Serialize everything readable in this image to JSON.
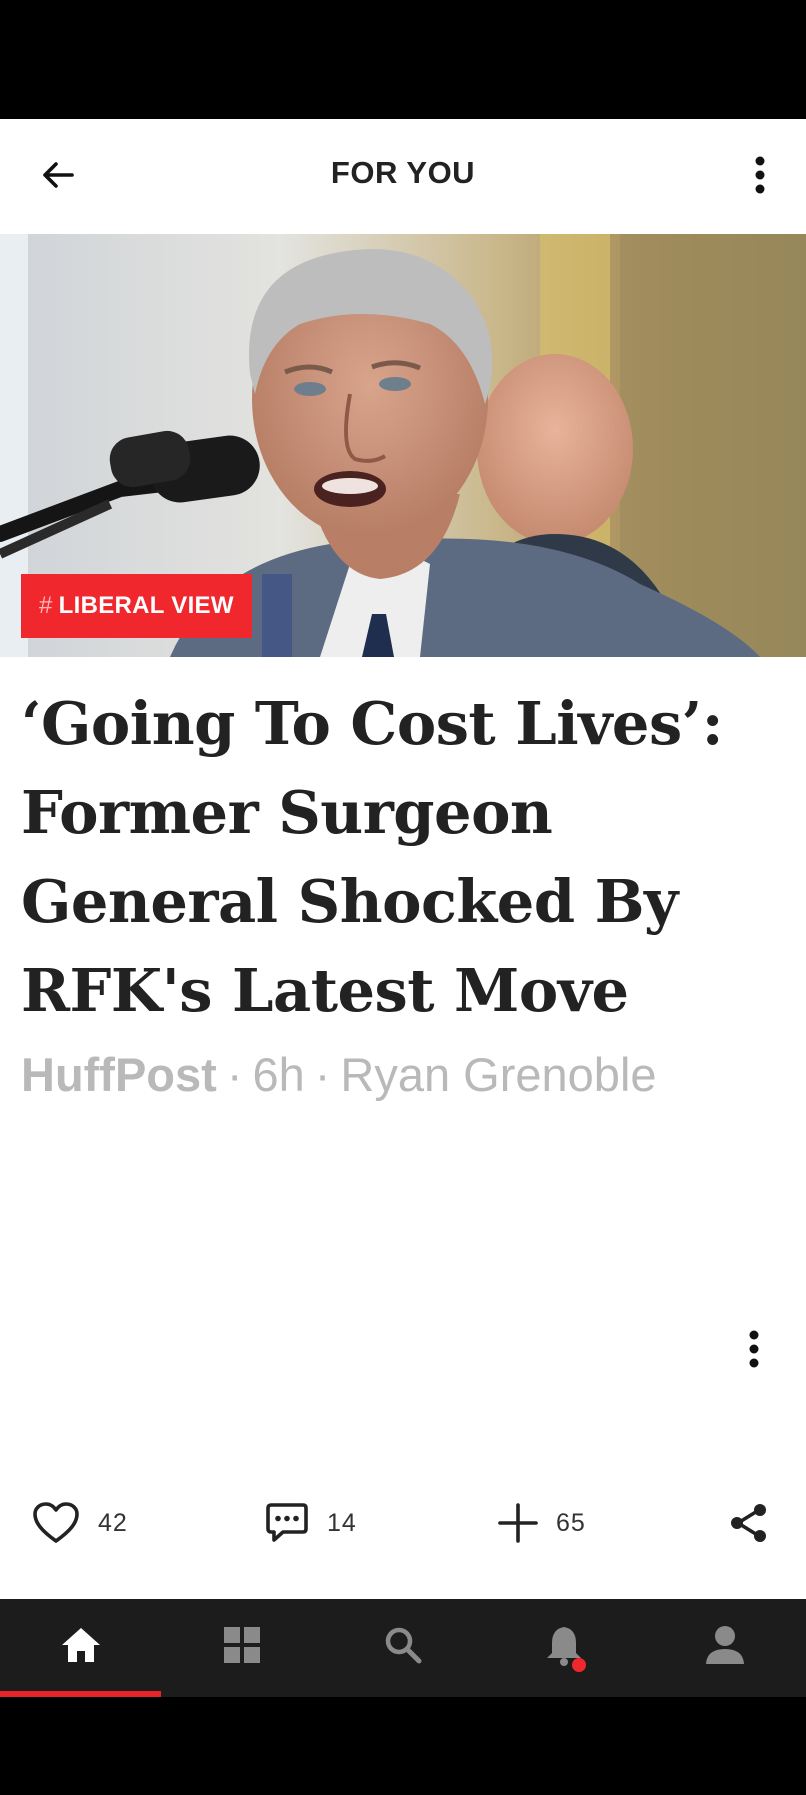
{
  "header": {
    "title": "FOR YOU",
    "back_icon": "arrow-left-icon",
    "more_icon": "more-vertical-icon"
  },
  "article": {
    "tag_hash": "#",
    "tag_label": "LIBERAL VIEW",
    "headline_lines": [
      "‘Going To Cost Lives’:",
      "Former Surgeon",
      "General Shocked By",
      "RFK's Latest Move"
    ],
    "source": "HuffPost",
    "separator": "·",
    "age": "6h",
    "author": "Ryan Grenoble",
    "image_alt": "Man speaking at microphone"
  },
  "actions": {
    "likes": "42",
    "comments": "14",
    "adds": "65"
  },
  "nav": {
    "items": [
      "home",
      "sections",
      "search",
      "notifications",
      "profile"
    ],
    "active": "home"
  },
  "colors": {
    "accent": "#f0282d",
    "text": "#222222",
    "meta": "#b9b9b9",
    "nav_bg": "#1c1c1c"
  }
}
